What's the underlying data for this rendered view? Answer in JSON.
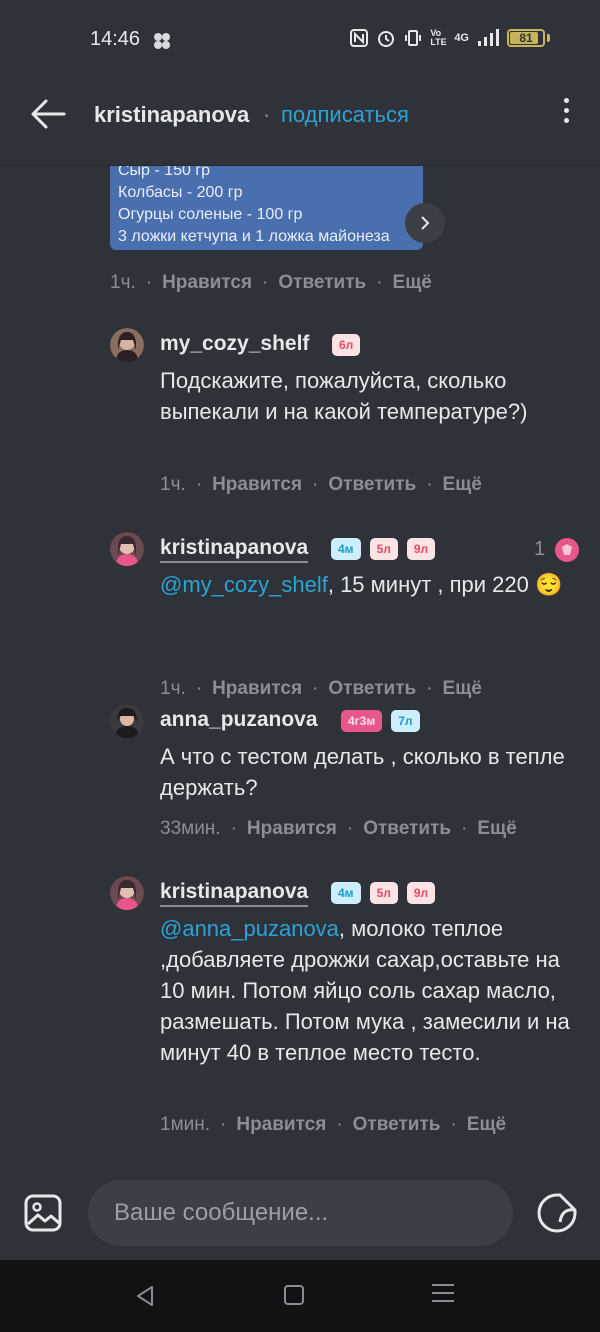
{
  "status_bar": {
    "time": "14:46",
    "battery_level": "81",
    "network": "4G",
    "volte": "Vo LTE",
    "icons": [
      "nfc-icon",
      "alarm-icon",
      "vibrate-icon",
      "volte-icon",
      "signal-icon",
      "battery-icon"
    ]
  },
  "header": {
    "username": "kristinapanova",
    "separator": "·",
    "subscribe_label": "подписаться"
  },
  "recipe_image": {
    "lines": [
      "Сыр - 150 гр",
      "Колбасы - 200 гр",
      "Огурцы соленые - 100 гр",
      "3 ложки кетчупа и 1 ложка майонеза"
    ]
  },
  "post_meta": {
    "time": "1ч.",
    "like": "Нравится",
    "reply": "Ответить",
    "more": "Ещё"
  },
  "comments": [
    {
      "username": "my_cozy_shelf",
      "badges": [
        "6л"
      ],
      "text": "Подскажите, пожалуйста, сколько выпекали и на какой температуре?)",
      "time": "1ч.",
      "like": "Нравится",
      "reply": "Ответить",
      "more": "Ещё"
    },
    {
      "username": "kristinapanova",
      "badges": [
        "4м",
        "5л",
        "9л"
      ],
      "mention": "@my_cozy_shelf",
      "text": ", 15 минут , при 220 😌",
      "like_count": "1",
      "time": "1ч.",
      "like": "Нравится",
      "reply": "Ответить",
      "more": "Ещё"
    },
    {
      "username": "anna_puzanova",
      "badges": [
        "4г3м",
        "7л"
      ],
      "text": "А что с тестом делать , сколько в тепле держать?",
      "time": "33мин.",
      "like": "Нравится",
      "reply": "Ответить",
      "more": "Ещё"
    },
    {
      "username": "kristinapanova",
      "badges": [
        "4м",
        "5л",
        "9л"
      ],
      "mention": "@anna_puzanova",
      "text": ", молоко теплое ,добавляете дрожжи сахар,оставьте на 10 мин. Потом яйцо соль сахар масло, размешать. Потом мука , замесили и на минут 40 в теплое место тесто.",
      "time": "1мин.",
      "like": "Нравится",
      "reply": "Ответить",
      "more": "Ещё"
    }
  ],
  "composer": {
    "placeholder": "Ваше сообщение..."
  },
  "colors": {
    "background": "#2f3238",
    "accent": "#2aa4d8",
    "like_pink": "#e8568a",
    "image_blue": "#4a6fae"
  }
}
